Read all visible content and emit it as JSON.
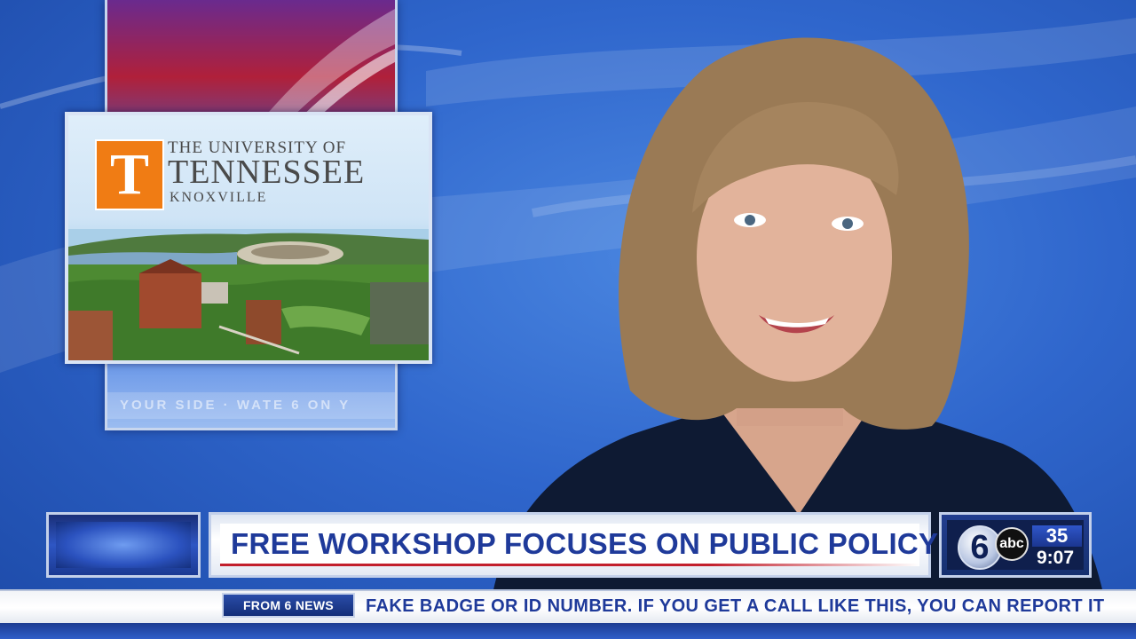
{
  "ots_graphic": {
    "logo_letter": "T",
    "line1": "THE UNIVERSITY OF",
    "line2": "TENNESSEE",
    "line3": "KNOXVILLE"
  },
  "background_monitor": {
    "ticker_text": "YOUR SIDE · WATE 6 ON Y"
  },
  "lower_third": {
    "headline": "FREE WORKSHOP FOCUSES ON PUBLIC POLICY"
  },
  "station_logo": {
    "channel_number": "6",
    "network": "abc",
    "sub_channel": "35",
    "time": "9:07"
  },
  "ticker": {
    "tag": "FROM 6 NEWS",
    "text": "FAKE BADGE OR ID NUMBER. IF YOU GET A CALL LIKE THIS, YOU CAN REPORT IT"
  },
  "colors": {
    "headline_blue": "#1f3a9a",
    "accent_red": "#c21f2c",
    "ut_orange": "#f07c14",
    "background_blue": "#2f66cc"
  }
}
